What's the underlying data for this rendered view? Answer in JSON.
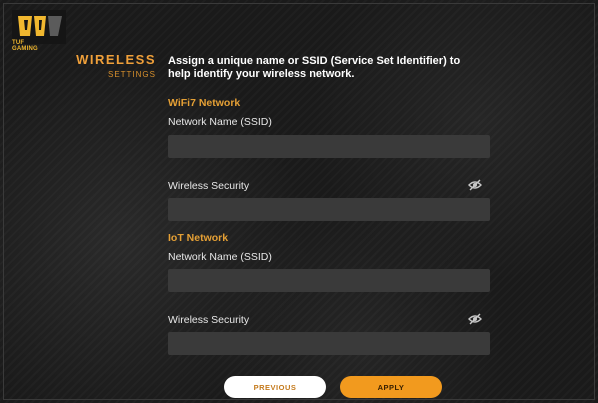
{
  "brand": {
    "logo_text": "TUF GAMING"
  },
  "sidebar": {
    "title": "WIRELESS",
    "subtitle": "SETTINGS"
  },
  "description": "Assign a unique name or SSID (Service Set Identifier) to help identify your wireless network.",
  "wifi7": {
    "section_title": "WiFi7 Network",
    "ssid_label": "Network Name (SSID)",
    "ssid_value": "",
    "security_label": "Wireless Security",
    "security_value": "",
    "visibility_icon": "eye-slash-icon"
  },
  "iot": {
    "section_title": "IoT Network",
    "ssid_label": "Network Name (SSID)",
    "ssid_value": "",
    "security_label": "Wireless Security",
    "security_value": "",
    "visibility_icon": "eye-slash-icon"
  },
  "buttons": {
    "previous": "PREVIOUS",
    "apply": "APPLY"
  },
  "colors": {
    "accent": "#f29a1e",
    "section": "#e5a035",
    "field_bg": "#3a3a3a",
    "background": "#1a1a1a"
  }
}
